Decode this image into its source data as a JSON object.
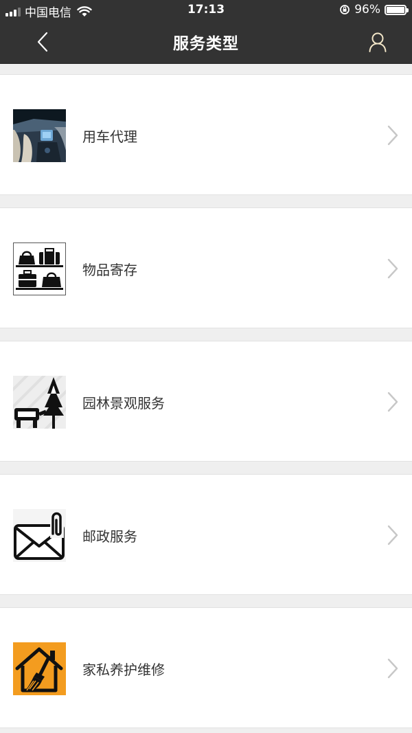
{
  "status_bar": {
    "carrier": "中国电信",
    "time": "17:13",
    "battery_text": "96%",
    "battery_level": 0.96
  },
  "header": {
    "title": "服务类型",
    "back_icon": "chevron-left-icon",
    "user_icon": "user-icon"
  },
  "services": [
    {
      "label": "用车代理",
      "icon": "car-interior-thumb"
    },
    {
      "label": "物品寄存",
      "icon": "luggage-storage-icon"
    },
    {
      "label": "园林景观服务",
      "icon": "landscape-bench-tree-icon"
    },
    {
      "label": "邮政服务",
      "icon": "mail-envelope-icon"
    },
    {
      "label": "家私养护维修",
      "icon": "house-broom-icon"
    }
  ],
  "colors": {
    "header_bg": "#333333",
    "page_bg": "#efefef",
    "item_bg": "#ffffff",
    "chevron": "#c7c7c7",
    "house_icon_bg": "#f39c1f"
  }
}
